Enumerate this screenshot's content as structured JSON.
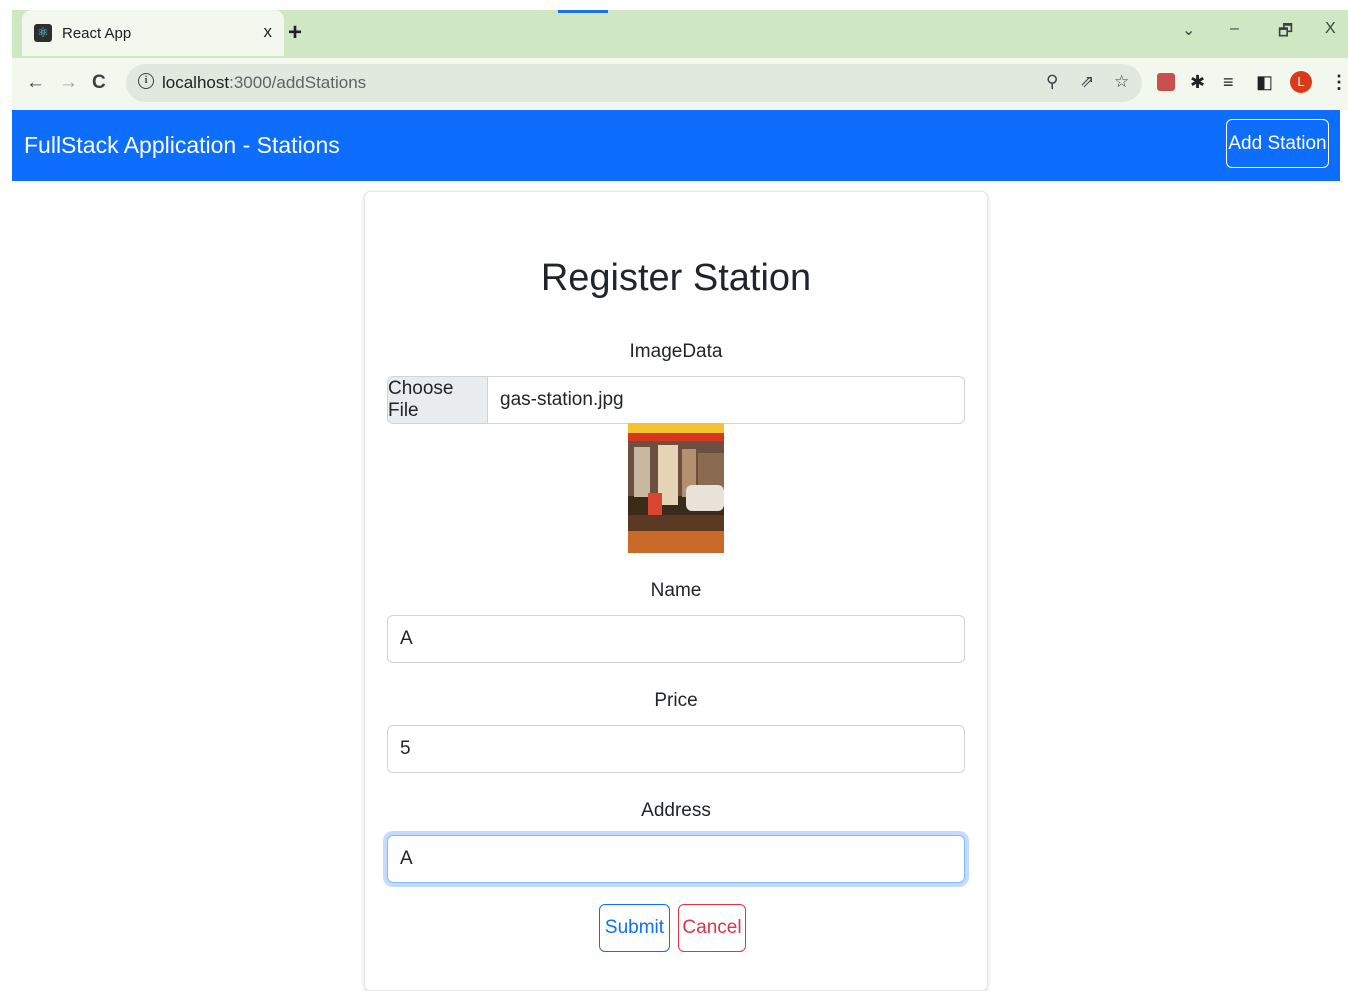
{
  "browser": {
    "tab_title": "React App",
    "tab_close": "x",
    "new_tab": "+",
    "url_host": "localhost",
    "url_rest": ":3000/addStations",
    "window_minimize": "–",
    "window_restore": "🗗",
    "window_close": "X",
    "window_menu": "⌄",
    "profile_initial": "L",
    "icons": [
      "back-arrow-icon",
      "forward-arrow-icon",
      "reload-icon",
      "info-icon",
      "zoom-icon",
      "share-icon",
      "star-icon",
      "extension-icon",
      "puzzle-icon",
      "reading-list-icon",
      "side-panel-icon",
      "menu-dots-icon"
    ]
  },
  "navbar": {
    "brand": "FullStack Application - Stations",
    "add_button": "Add Station",
    "color": "#0d6efd"
  },
  "form": {
    "title": "Register Station",
    "image_label": "ImageData",
    "file_button": "Choose File",
    "file_name": "gas-station.jpg",
    "name_label": "Name",
    "name_value": "A",
    "price_label": "Price",
    "price_value": "5",
    "address_label": "Address",
    "address_value": "A",
    "submit_label": "Submit",
    "cancel_label": "Cancel"
  }
}
